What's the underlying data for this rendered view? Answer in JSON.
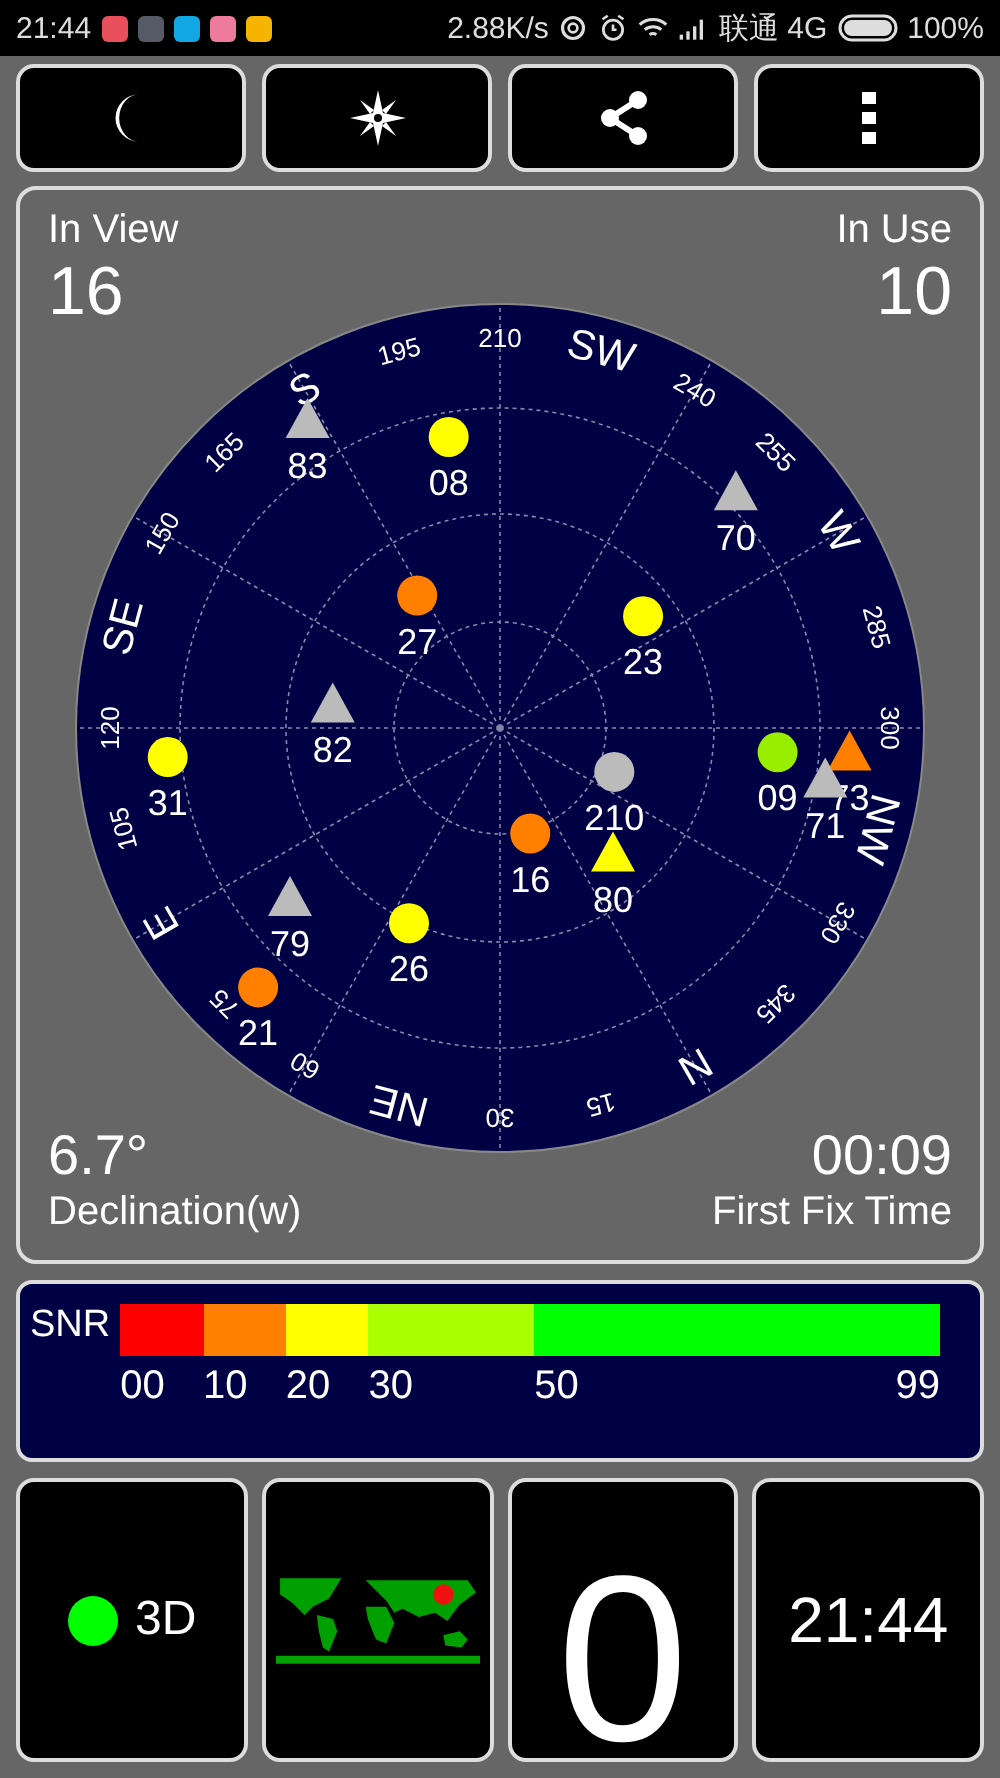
{
  "status_bar": {
    "time": "21:44",
    "app_icons": [
      {
        "color": "#e8505b"
      },
      {
        "color": "#555a66"
      },
      {
        "color": "#12a8e6"
      },
      {
        "color": "#ef7b9c"
      },
      {
        "color": "#f4b400"
      }
    ],
    "speed": "2.88K/s",
    "carrier": "联通 4G",
    "battery": "100%"
  },
  "toolbar": [
    {
      "kind": "night"
    },
    {
      "kind": "compass"
    },
    {
      "kind": "share"
    },
    {
      "kind": "more"
    }
  ],
  "sky": {
    "in_view_label": "In View",
    "in_view": "16",
    "in_use_label": "In Use",
    "in_use": "10",
    "compass_labels": [
      "N",
      "15",
      "30",
      "NE",
      "60",
      "75",
      "E",
      "105",
      "120",
      "SE",
      "150",
      "165",
      "S",
      "195",
      "210",
      "SW",
      "240",
      "255",
      "W",
      "285",
      "300",
      "NW",
      "330",
      "345"
    ],
    "satellites": [
      {
        "label": "83",
        "kind": "triangle",
        "color": "#bbbbbb"
      },
      {
        "label": "08",
        "kind": "circle",
        "color": "#ffff00"
      },
      {
        "label": "70",
        "kind": "triangle",
        "color": "#bbbbbb"
      },
      {
        "label": "27",
        "kind": "circle",
        "color": "#ff7f00"
      },
      {
        "label": "23",
        "kind": "circle",
        "color": "#ffff00"
      },
      {
        "label": "82",
        "kind": "triangle",
        "color": "#bbbbbb"
      },
      {
        "label": "31",
        "kind": "circle",
        "color": "#ffff00"
      },
      {
        "label": "09",
        "kind": "circle",
        "color": "#99ee00"
      },
      {
        "label": "73",
        "kind": "triangle",
        "color": "#ff7f00"
      },
      {
        "label": "71",
        "kind": "triangle",
        "color": "#bbbbbb"
      },
      {
        "label": "210",
        "kind": "circle",
        "color": "#bbbbbb"
      },
      {
        "label": "16",
        "kind": "circle",
        "color": "#ff7f00"
      },
      {
        "label": "80",
        "kind": "triangle",
        "color": "#ffff00"
      },
      {
        "label": "79",
        "kind": "triangle",
        "color": "#bbbbbb"
      },
      {
        "label": "26",
        "kind": "circle",
        "color": "#ffff00"
      },
      {
        "label": "21",
        "kind": "circle",
        "color": "#ff7f00"
      }
    ],
    "declination": "6.7°",
    "declination_label": "Declination(w)",
    "first_fix": "00:09",
    "first_fix_label": "First Fix Time"
  },
  "snr": {
    "label": "SNR",
    "segments": [
      {
        "label": "00",
        "color": "#ff0000"
      },
      {
        "label": "10",
        "color": "#ff7f00"
      },
      {
        "label": "20",
        "color": "#ffff00"
      },
      {
        "label": "30",
        "color": "#aaff00"
      },
      {
        "label": "50",
        "color": "#00ff00"
      }
    ],
    "end_label": "99"
  },
  "tiles": {
    "fix": {
      "label": "3D",
      "color": "#00ff00"
    },
    "speed": "0",
    "clock": "21:44"
  }
}
